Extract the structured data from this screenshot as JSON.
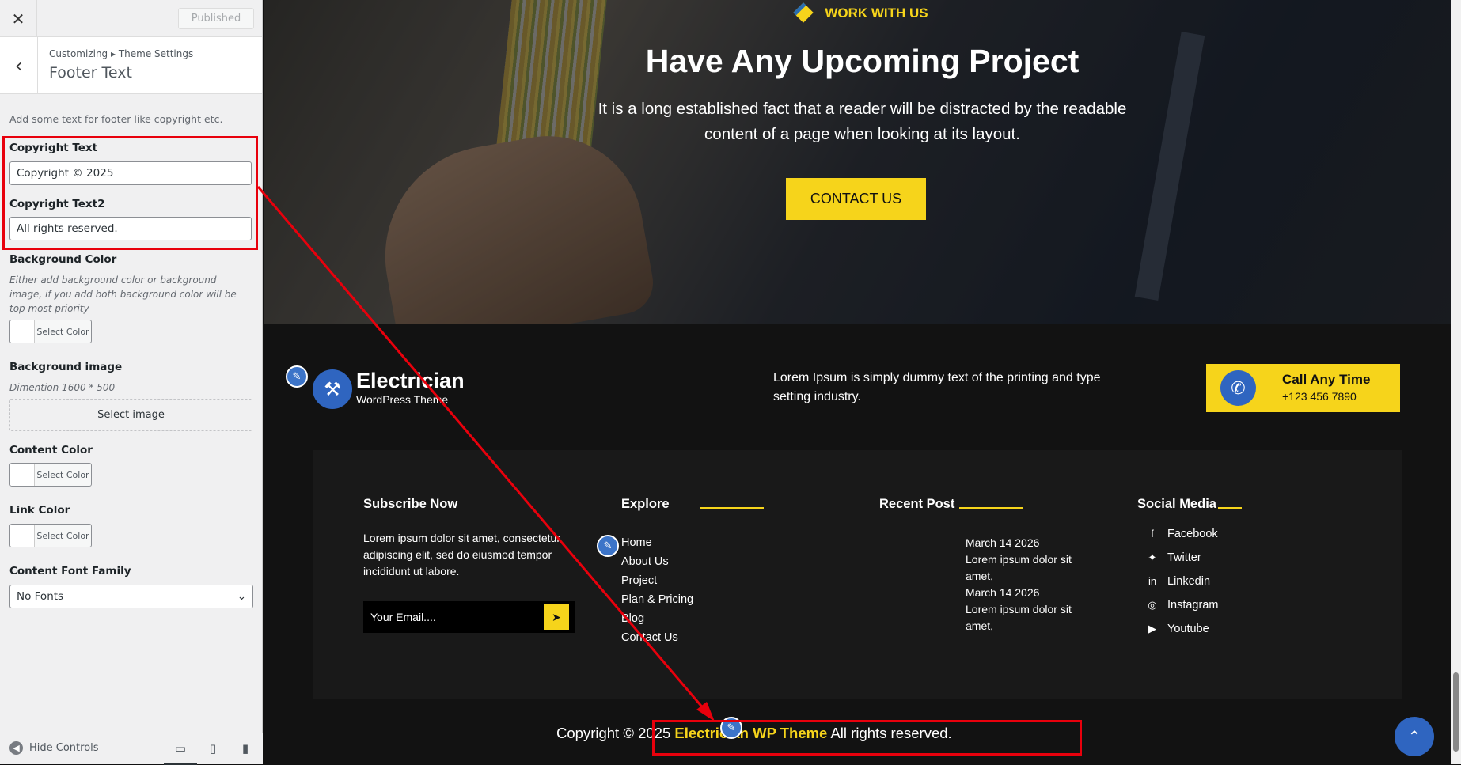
{
  "customizer": {
    "close_icon": "close-icon",
    "published_label": "Published",
    "breadcrumb": "Customizing ▸ Theme Settings",
    "section_title": "Footer Text",
    "description": "Add some text for footer like copyright etc.",
    "copyright_label": "Copyright Text",
    "copyright_value": "Copyright © 2025",
    "copyright2_label": "Copyright Text2",
    "copyright2_value": "All rights reserved.",
    "bg_color_label": "Background Color",
    "bg_color_hint": "Either add background color or background image, if you add both background color will be top most priority",
    "select_color": "Select Color",
    "bg_image_label": "Background image",
    "bg_image_hint": "Dimention 1600 * 500",
    "select_image": "Select image",
    "content_color_label": "Content Color",
    "link_color_label": "Link Color",
    "font_family_label": "Content Font Family",
    "font_family_value": "No Fonts",
    "hide_controls": "Hide Controls"
  },
  "hero": {
    "eyebrow": "WORK WITH US",
    "title": "Have Any Upcoming Project",
    "text": "It is a long established fact that a reader will be distracted by the readable content of a page when looking at its layout.",
    "button": "CONTACT US"
  },
  "footer": {
    "logo_name": "Electrician",
    "logo_sub": "WordPress Theme",
    "lead": "Lorem Ipsum is simply dummy text of the printing and type setting industry.",
    "call_title": "Call Any Time",
    "call_number": "+123 456 7890",
    "subscribe_heading": "Subscribe Now",
    "subscribe_text": "Lorem ipsum dolor sit amet, consectetur adipiscing elit, sed do eiusmod tempor incididunt ut labore.",
    "email_placeholder": "Your Email....",
    "explore_heading": "Explore",
    "explore_links": [
      "Home",
      "About Us",
      "Project",
      "Plan & Pricing",
      "Blog",
      "Contact Us"
    ],
    "recent_heading": "Recent Post",
    "recent_posts": [
      {
        "date": "March 14 2026",
        "title": "Lorem ipsum dolor sit amet,"
      },
      {
        "date": "March 14 2026",
        "title": "Lorem ipsum dolor sit amet,"
      }
    ],
    "social_heading": "Social Media",
    "social_links": [
      "Facebook",
      "Twitter",
      "Linkedin",
      "Instagram",
      "Youtube"
    ],
    "copyright_prefix": "Copyright © 2025",
    "copyright_brand": "Electrician WP Theme",
    "copyright_suffix": "All rights reserved."
  },
  "colors": {
    "accent": "#f6d41b",
    "brand_blue": "#2f65c0",
    "highlight": "#e8000c"
  }
}
